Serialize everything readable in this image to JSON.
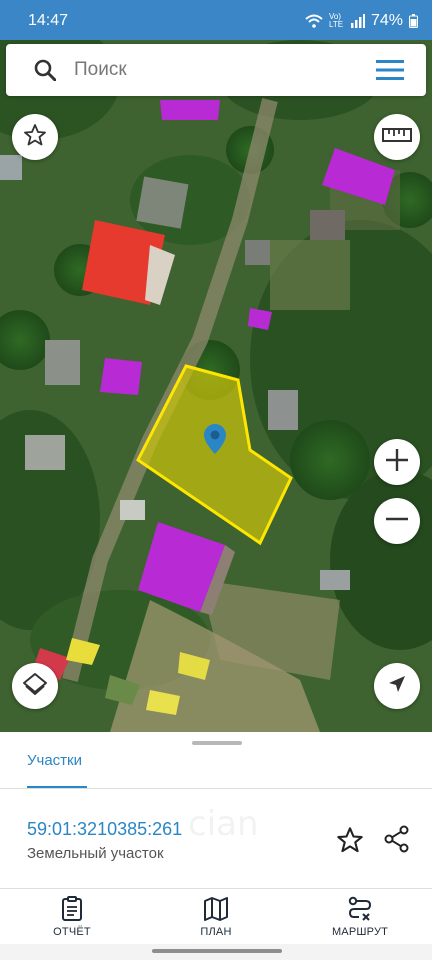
{
  "status_bar": {
    "time": "14:47",
    "battery": "74%",
    "network": "Vo) LTE",
    "icons": [
      "wifi-icon",
      "signal-icon",
      "battery-icon"
    ]
  },
  "search": {
    "placeholder": "Поиск",
    "icons": [
      "search-icon",
      "menu-icon"
    ]
  },
  "map": {
    "controls": [
      "favorite-star-icon",
      "ruler-icon",
      "zoom-in-icon",
      "zoom-out-icon",
      "layers-icon",
      "navigation-arrow-icon"
    ],
    "highlight_color": "#ffe600",
    "building_highlight_color": "#c02ad0",
    "marker_color": "#2b86c5"
  },
  "sheet": {
    "tab_label": "Участки",
    "parcel_number": "59:01:3210385:261",
    "parcel_type": "Земельный участок",
    "watermark": "cian",
    "action_icons": [
      "star-outline-icon",
      "share-icon"
    ]
  },
  "bottom_nav": {
    "report_label": "ОТЧЁТ",
    "plan_label": "ПЛАН",
    "route_label": "МАРШРУТ"
  },
  "colors": {
    "accent": "#2b86c5",
    "status_bar": "#3a86c6"
  }
}
